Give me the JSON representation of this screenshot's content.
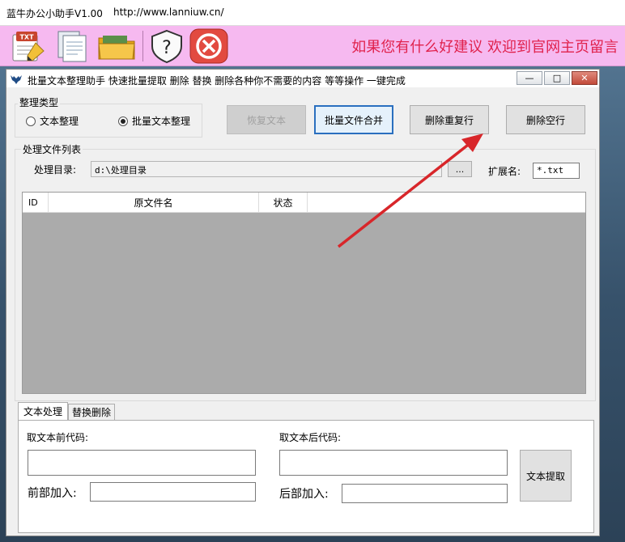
{
  "outer": {
    "title": "蓝牛办公小助手V1.00",
    "url": "http://www.lanniuw.cn/"
  },
  "toolbar": {
    "message": "如果您有什么好建议 欢迎到官网主页留言",
    "icons": [
      "txt-edit-icon",
      "documents-icon",
      "folder-icon",
      "help-icon",
      "close-icon"
    ],
    "colors": {
      "background": "#f6b9f0",
      "message": "#e0224d"
    }
  },
  "window": {
    "title": "批量文本整理助手   快速批量提取 删除 替换 删除各种你不需要的内容 等等操作 一键完成",
    "buttons": {
      "minimize": "—",
      "maximize": "□",
      "close": "✕"
    }
  },
  "type_group": {
    "label": "整理类型",
    "options": [
      {
        "label": "文本整理",
        "selected": false
      },
      {
        "label": "批量文本整理",
        "selected": true
      }
    ]
  },
  "actions": {
    "restore": "恢复文本",
    "merge": "批量文件合并",
    "dedupe": "删除重复行",
    "remove_blank": "删除空行"
  },
  "file_list": {
    "label": "处理文件列表",
    "dir_label": "处理目录:",
    "dir_value": "d:\\处理目录",
    "browse": "...",
    "ext_label": "扩展名:",
    "ext_value": "*.txt",
    "columns": [
      "ID",
      "原文件名",
      "状态"
    ]
  },
  "tabs": [
    "文本处理",
    "替换删除"
  ],
  "text_tab": {
    "before_code_label": "取文本前代码:",
    "after_code_label": "取文本后代码:",
    "prefix_label": "前部加入:",
    "suffix_label": "后部加入:",
    "extract_button": "文本提取"
  }
}
